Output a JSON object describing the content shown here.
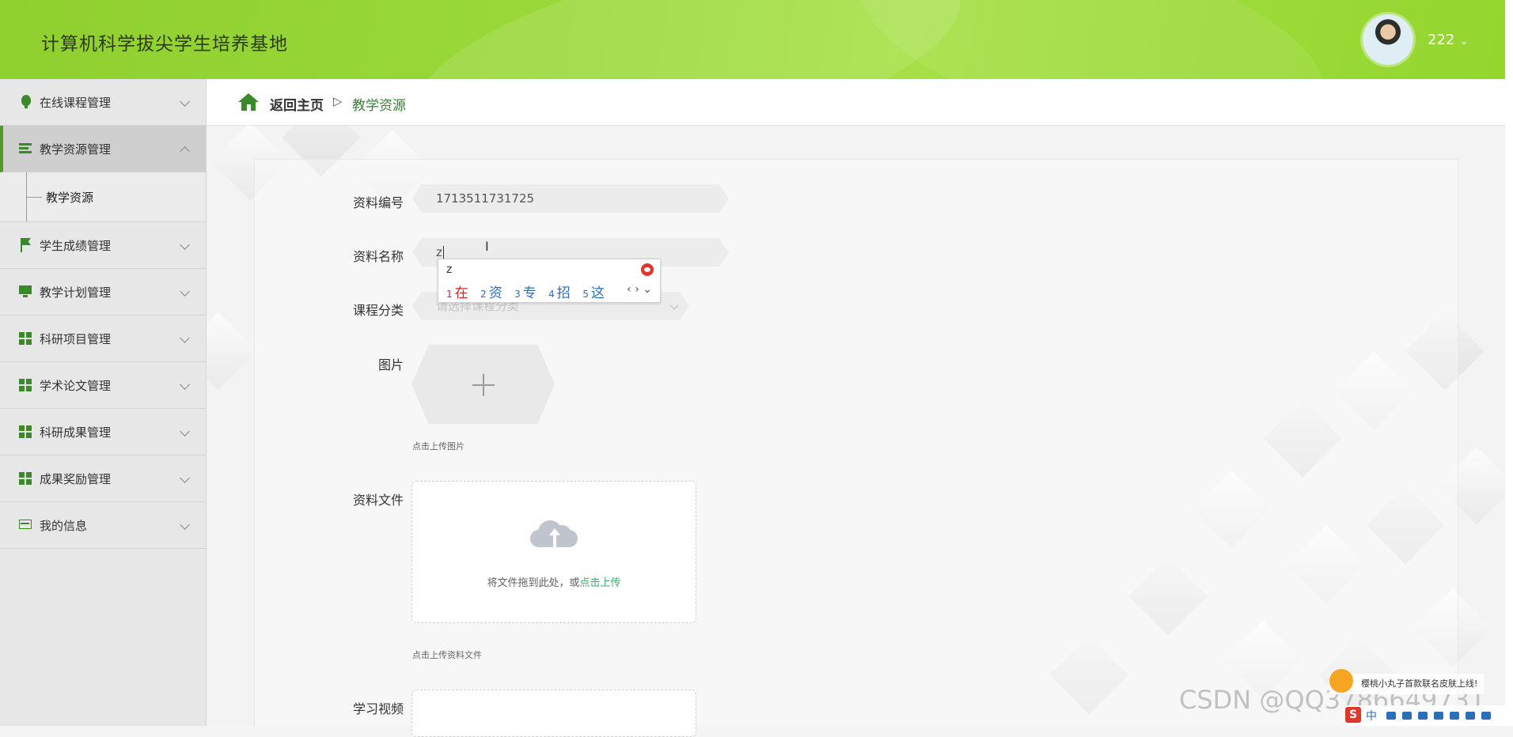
{
  "header": {
    "title": "计算机科学拔尖学生培养基地",
    "username": "222",
    "dropdown_symbol": "⌄"
  },
  "sidebar": {
    "items": [
      {
        "label": "在线课程管理",
        "icon": "bulb-icon"
      },
      {
        "label": "教学资源管理",
        "icon": "list-icon",
        "expanded": true
      },
      {
        "label": "学生成绩管理",
        "icon": "flag-icon"
      },
      {
        "label": "教学计划管理",
        "icon": "monitor-icon"
      },
      {
        "label": "科研项目管理",
        "icon": "grid-icon"
      },
      {
        "label": "学术论文管理",
        "icon": "grid-icon"
      },
      {
        "label": "科研成果管理",
        "icon": "grid-icon"
      },
      {
        "label": "成果奖励管理",
        "icon": "grid-icon"
      },
      {
        "label": "我的信息",
        "icon": "card-icon"
      }
    ],
    "submenu": {
      "label": "教学资源"
    }
  },
  "breadcrumb": {
    "home": "返回主页",
    "separator": "▷",
    "current": "教学资源"
  },
  "form": {
    "id_label": "资料编号",
    "id_value": "1713511731725",
    "name_label": "资料名称",
    "name_value": "z",
    "category_label": "课程分类",
    "category_placeholder": "请选择课程分类",
    "image_label": "图片",
    "image_hint": "点击上传图片",
    "file_label": "资料文件",
    "file_drop_text": "将文件拖到此处，或",
    "file_drop_link": "点击上传",
    "file_hint": "点击上传资料文件",
    "video_label": "学习视频"
  },
  "ime": {
    "typed": "z",
    "candidates": [
      {
        "num": "1",
        "text": "在"
      },
      {
        "num": "2",
        "text": "资"
      },
      {
        "num": "3",
        "text": "专"
      },
      {
        "num": "4",
        "text": "招"
      },
      {
        "num": "5",
        "text": "这"
      }
    ],
    "nav": "‹ › ⌄"
  },
  "overlay": {
    "watermark": "CSDN @QQ3786649731",
    "ime_tip": "樱桃小丸子首款联名皮肤上线!",
    "tray_logo": "S",
    "tray_lang": "中"
  },
  "colors": {
    "header_green": "#9ad83a",
    "accent_green": "#3a8a2a",
    "breadcrumb_current": "#3b7d3b",
    "ime_red": "#d42525",
    "ime_blue": "#2a6fb8"
  }
}
